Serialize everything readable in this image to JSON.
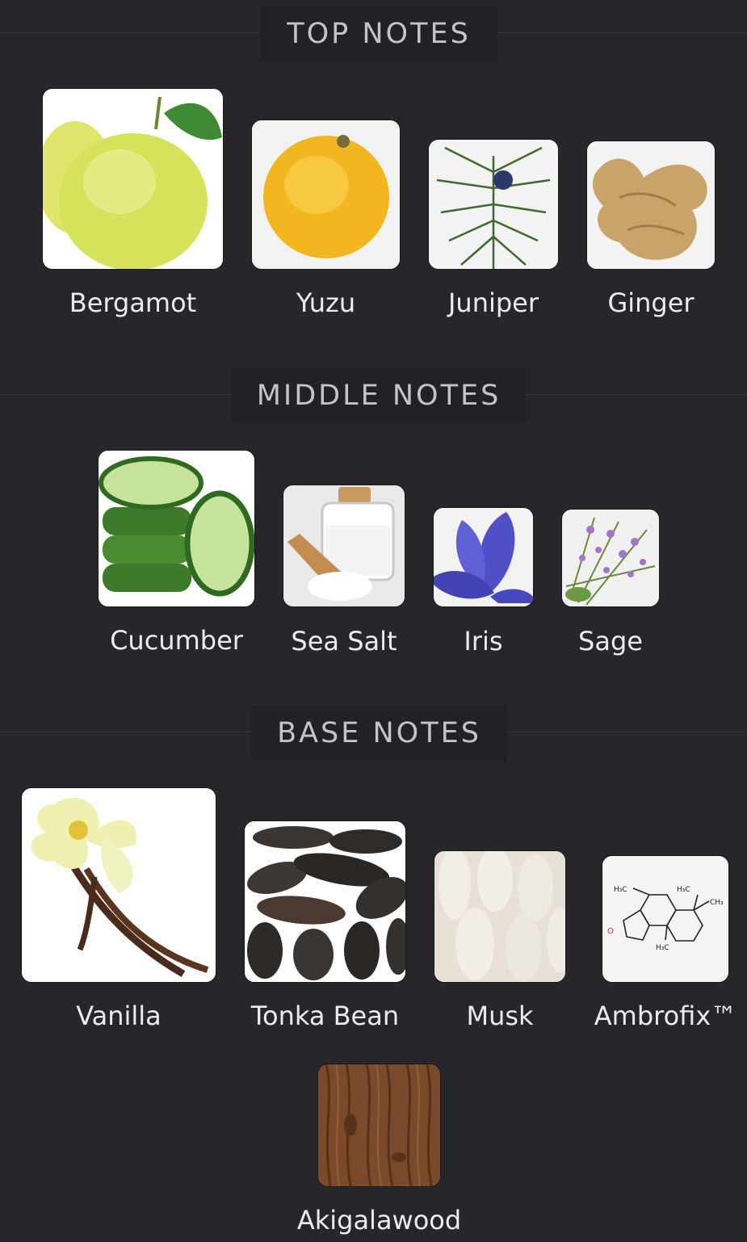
{
  "sections": {
    "top": {
      "title": "TOP NOTES",
      "notes": [
        {
          "label": "Bergamot",
          "image": "bergamot-image"
        },
        {
          "label": "Yuzu",
          "image": "yuzu-image"
        },
        {
          "label": "Juniper",
          "image": "juniper-image"
        },
        {
          "label": "Ginger",
          "image": "ginger-image"
        }
      ]
    },
    "middle": {
      "title": "MIDDLE NOTES",
      "notes": [
        {
          "label": "Cucumber",
          "image": "cucumber-image"
        },
        {
          "label": "Sea Salt",
          "image": "sea-salt-image"
        },
        {
          "label": "Iris",
          "image": "iris-image"
        },
        {
          "label": "Sage",
          "image": "sage-image"
        }
      ]
    },
    "base": {
      "title": "BASE NOTES",
      "notes": [
        {
          "label": "Vanilla",
          "image": "vanilla-image"
        },
        {
          "label": "Tonka Bean",
          "image": "tonka-bean-image"
        },
        {
          "label": "Musk",
          "image": "musk-image"
        },
        {
          "label": "Ambrofix™",
          "image": "ambrofix-molecule-image"
        },
        {
          "label": "Akigalawood",
          "image": "akigalawood-image"
        }
      ]
    }
  },
  "colors": {
    "background": "#26262b",
    "header_text": "#c3c3c8",
    "label_text": "#ececf0"
  }
}
